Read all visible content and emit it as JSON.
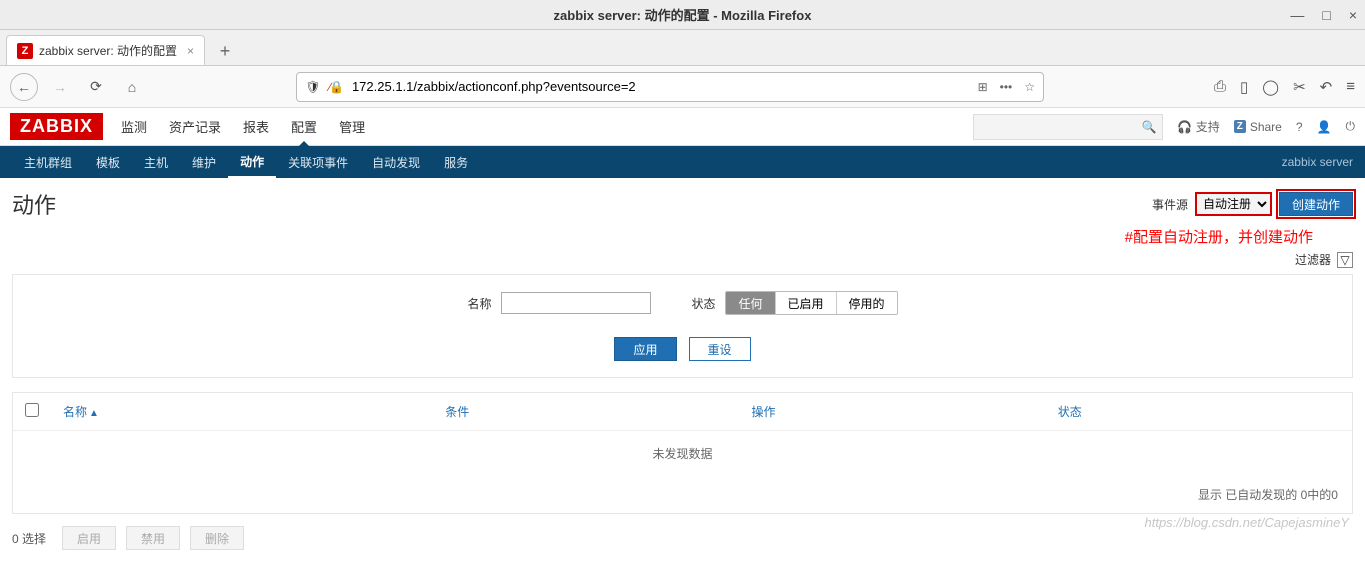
{
  "os": {
    "title": "zabbix server: 动作的配置 - Mozilla Firefox",
    "min": "—",
    "max": "□",
    "close": "×"
  },
  "tab": {
    "favicon": "Z",
    "title": "zabbix server: 动作的配置",
    "close": "×",
    "plus": "+"
  },
  "browser": {
    "back": "←",
    "fwd": "→",
    "reload": "⟳",
    "home": "⌂",
    "shield": "🛡",
    "crossed": "✕",
    "url": "172.25.1.1/zabbix/actionconf.php?eventsource=2",
    "qr": "⊞",
    "more": "•••",
    "star": "☆",
    "lib": "⎙",
    "side": "▯",
    "pocket": "◯",
    "crop": "✂",
    "undo": "↶",
    "menu": "≡"
  },
  "zbx": {
    "logo": "ZABBIX",
    "main_nav": [
      "监测",
      "资产记录",
      "报表",
      "配置",
      "管理"
    ],
    "main_active_idx": 3,
    "support": "支持",
    "share": "Share",
    "help": "?",
    "user": "👤",
    "power": "⏻",
    "sub_nav": [
      "主机群组",
      "模板",
      "主机",
      "维护",
      "动作",
      "关联项事件",
      "自动发现",
      "服务"
    ],
    "sub_active_idx": 4,
    "server": "zabbix server"
  },
  "page": {
    "title": "动作",
    "evsrc_label": "事件源",
    "evsrc_value": "自动注册",
    "create_btn": "创建动作",
    "annotation": "#配置自动注册，并创建动作",
    "filter_label": "过滤器",
    "funnel": "▽"
  },
  "filter": {
    "name_label": "名称",
    "status_label": "状态",
    "seg": [
      "任何",
      "已启用",
      "停用的"
    ],
    "seg_sel_idx": 0,
    "apply": "应用",
    "reset": "重设"
  },
  "table": {
    "cols": [
      "名称",
      "条件",
      "操作",
      "状态"
    ],
    "sort_asc": "▲",
    "empty": "未发现数据",
    "footer": "显示 已自动发现的 0中的0"
  },
  "bottom": {
    "count": "0 选择",
    "btns": [
      "启用",
      "禁用",
      "删除"
    ]
  },
  "watermark": "https://blog.csdn.net/CapejasmineY"
}
